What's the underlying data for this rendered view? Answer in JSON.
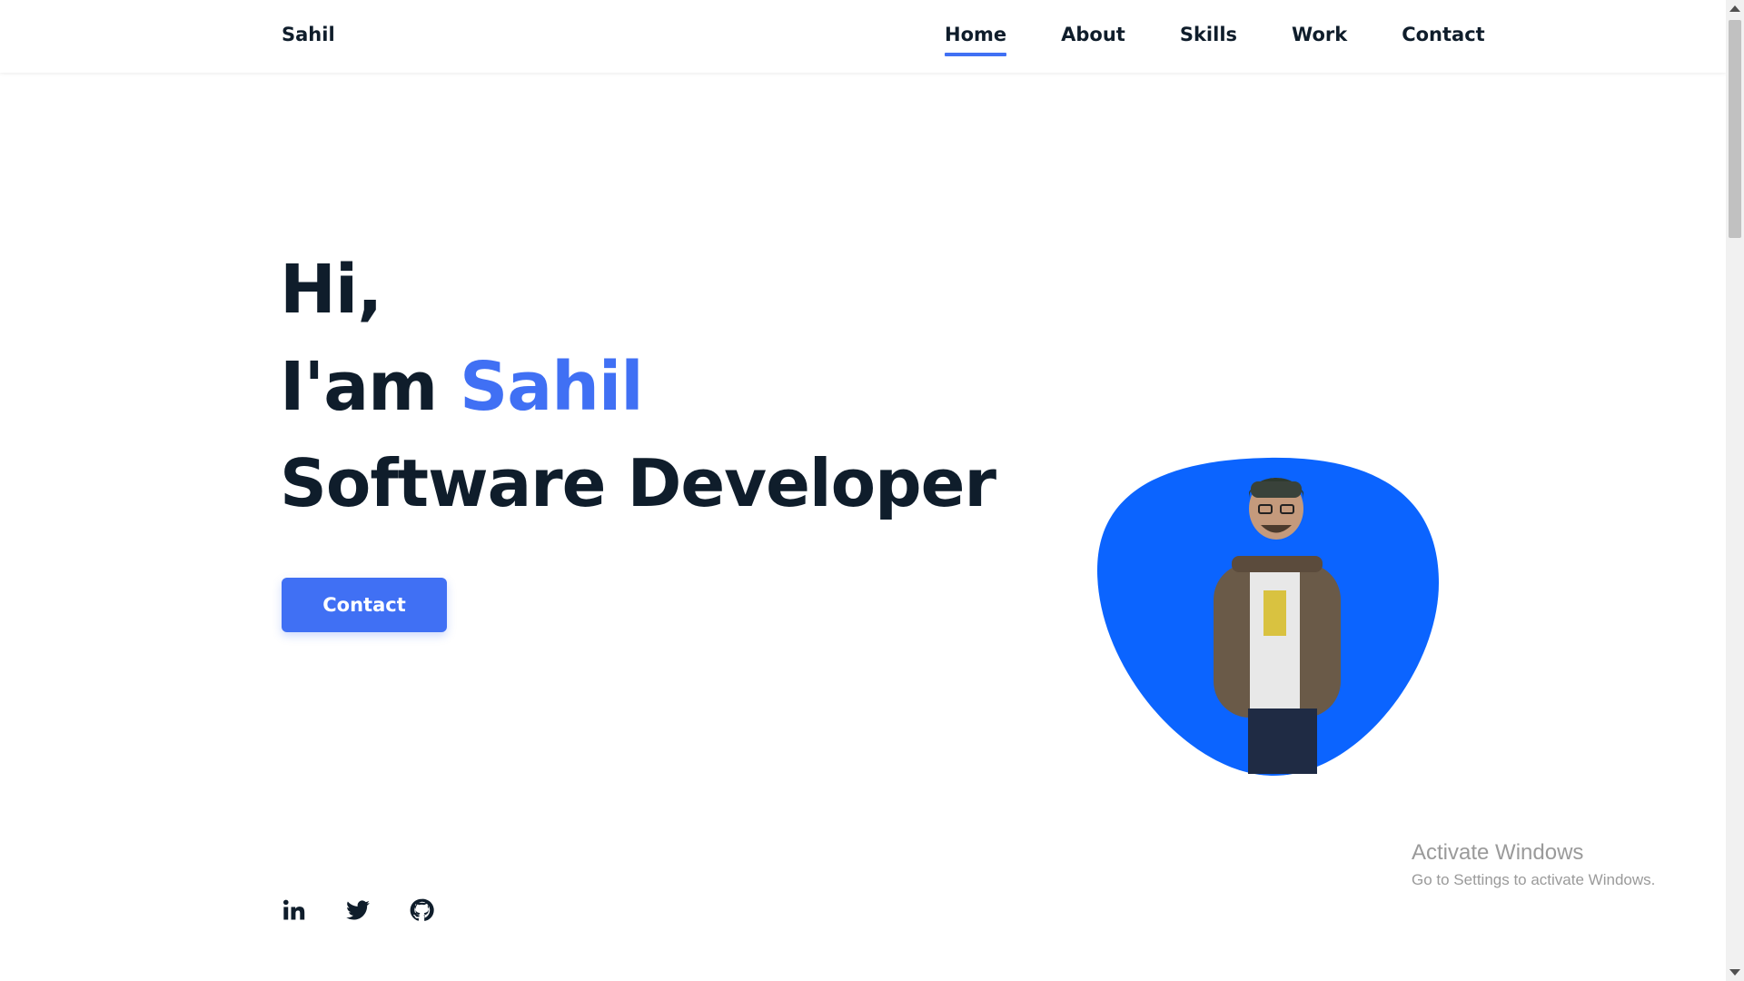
{
  "header": {
    "logo": "Sahil",
    "nav": [
      {
        "label": "Home",
        "active": true
      },
      {
        "label": "About",
        "active": false
      },
      {
        "label": "Skills",
        "active": false
      },
      {
        "label": "Work",
        "active": false
      },
      {
        "label": "Contact",
        "active": false
      }
    ]
  },
  "hero": {
    "greeting": "Hi,",
    "intro_prefix": "I'am ",
    "name": "Sahil",
    "role": "Software Developer",
    "contact_button": "Contact",
    "avatar_icon": "person-photo"
  },
  "socials": [
    {
      "icon": "linkedin-icon"
    },
    {
      "icon": "twitter-icon"
    },
    {
      "icon": "github-icon"
    }
  ],
  "watermark": {
    "title": "Activate Windows",
    "subtitle": "Go to Settings to activate Windows."
  },
  "colors": {
    "accent": "#4070f4",
    "text": "#0f1d2b",
    "blob": "#0b64ff"
  }
}
